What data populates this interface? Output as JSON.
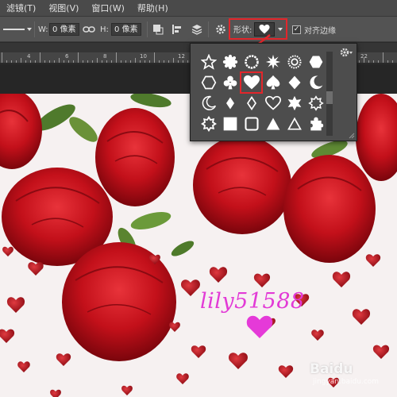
{
  "menubar": {
    "items": [
      "滤镜(T)",
      "视图(V)",
      "窗口(W)",
      "帮助(H)"
    ]
  },
  "options": {
    "w_label": "W:",
    "w_value": "0 像素",
    "h_label": "H:",
    "h_value": "0 像素",
    "shape_label": "形状:",
    "align_label": "对齐边缘",
    "align_checked": true
  },
  "ruler": {
    "labels": [
      "4",
      "6",
      "8",
      "10",
      "12",
      "14",
      "16",
      "18",
      "20",
      "22"
    ]
  },
  "shape_picker": {
    "selected_shape": "heart",
    "shapes": [
      "star-outline",
      "seal-outline",
      "seal-ring",
      "burst",
      "sun",
      "hexagon-outline",
      "hexagon",
      "club",
      "heart",
      "spade",
      "diamond",
      "crescent",
      "crescent-outline",
      "diamond-outline",
      "diamond-hollow",
      "heart-outline",
      "eight-point-star",
      "starburst-outline",
      "starburst-small",
      "square",
      "rounded-square",
      "triangle",
      "triangle-outline",
      "puzzle"
    ]
  },
  "canvas": {
    "watermark": "lily51588",
    "source_watermark": "Baidu",
    "source_watermark_sub": "jingyan.baidu.com"
  },
  "colors": {
    "accent_highlight": "#e3262b",
    "watermark": "#e23ad6",
    "rose": "#c8101a",
    "ui_panel": "#4d4d4d"
  }
}
